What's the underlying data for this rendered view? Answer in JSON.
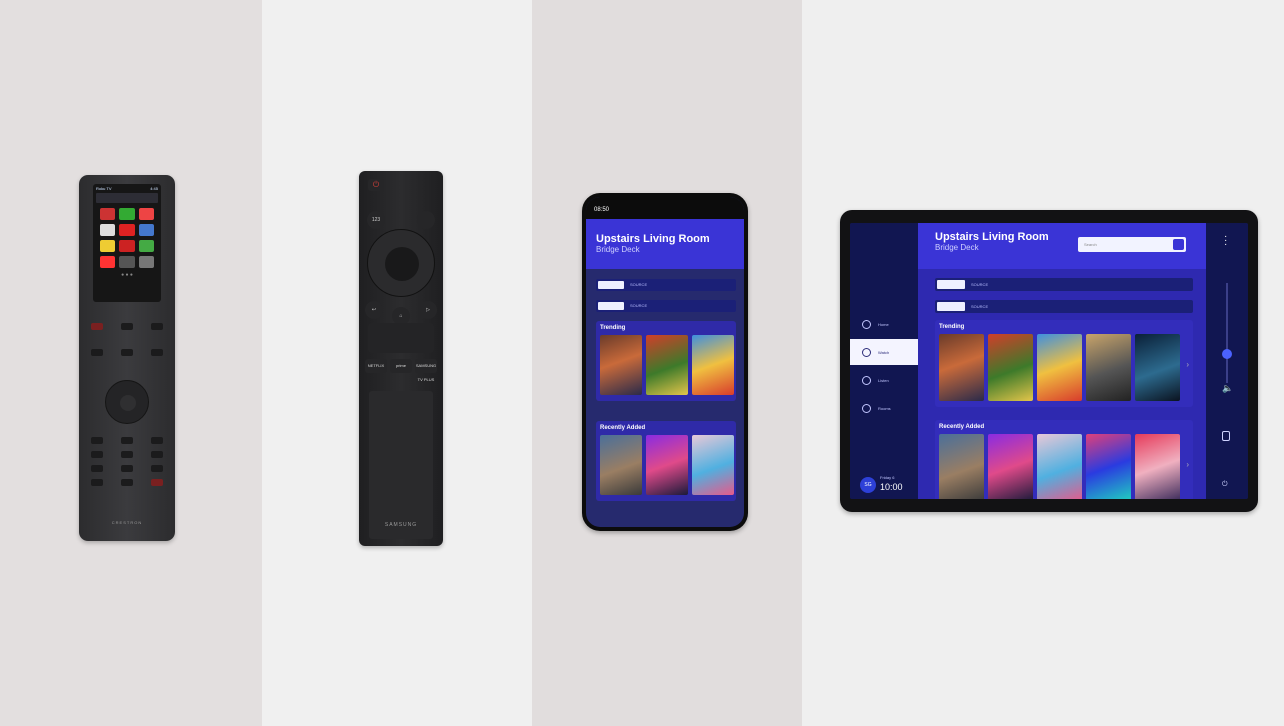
{
  "crestron": {
    "brand": "CRESTRON",
    "screen_title": "Roku TV",
    "screen_time": "4:45"
  },
  "samsung": {
    "brand": "SAMSUNG",
    "power_icon": "power-icon",
    "num_label": "123",
    "app_buttons": [
      "NETFLIX",
      "prime",
      "SAMSUNG TV PLUS"
    ]
  },
  "phone": {
    "status_time": "08:50",
    "room_title": "Upstairs Living Room",
    "room_subtitle": "Bridge Deck",
    "selectors": [
      "SOURCE",
      "SOURCE"
    ],
    "sections": [
      "Trending",
      "Recently Added"
    ]
  },
  "tablet": {
    "room_title": "Upstairs Living Room",
    "room_subtitle": "Bridge Deck",
    "search_placeholder": "Search",
    "nav": [
      "Home",
      "Watch",
      "Listen",
      "Rooms"
    ],
    "selectors": [
      "SOURCE",
      "SOURCE"
    ],
    "sections": [
      "Trending",
      "Recently Added"
    ],
    "avatar_initials": "SG",
    "day": "Friday 6",
    "time": "10:00"
  },
  "colors": {
    "accent": "#3a34d6",
    "nav_bg": "#111651",
    "content_bg": "#2e29b0"
  }
}
